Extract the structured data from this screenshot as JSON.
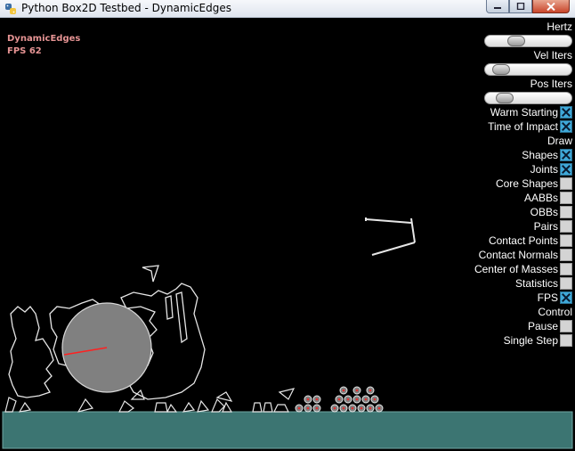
{
  "window": {
    "title": "Python Box2D Testbed - DynamicEdges"
  },
  "hud": {
    "test_name": "DynamicEdges",
    "fps_text": "FPS 62"
  },
  "colors": {
    "ground": "#3c7572",
    "shape_outline": "#e6e6e6",
    "circle_fill": "#808080",
    "joint_line": "#ff2020",
    "hud_text": "#e69494",
    "checkbox_on": "#3fa9d9"
  },
  "panel": {
    "hertz": {
      "label": "Hertz",
      "value_fraction": 0.32
    },
    "vel_iters": {
      "label": "Vel Iters",
      "value_fraction": 0.1
    },
    "pos_iters": {
      "label": "Pos Iters",
      "value_fraction": 0.15
    },
    "warm_starting": {
      "label": "Warm Starting",
      "checked": true
    },
    "time_of_impact": {
      "label": "Time of Impact",
      "checked": true
    },
    "draw_header": "Draw",
    "shapes": {
      "label": "Shapes",
      "checked": true
    },
    "joints": {
      "label": "Joints",
      "checked": true
    },
    "core_shapes": {
      "label": "Core Shapes",
      "checked": false
    },
    "aabbs": {
      "label": "AABBs",
      "checked": false
    },
    "obbs": {
      "label": "OBBs",
      "checked": false
    },
    "pairs": {
      "label": "Pairs",
      "checked": false
    },
    "contact_points": {
      "label": "Contact Points",
      "checked": false
    },
    "contact_normals": {
      "label": "Contact Normals",
      "checked": false
    },
    "center_of_masses": {
      "label": "Center of Masses",
      "checked": false
    },
    "statistics": {
      "label": "Statistics",
      "checked": false
    },
    "fps": {
      "label": "FPS",
      "checked": true
    },
    "control_header": "Control",
    "pause": {
      "label": "Pause",
      "checked": false
    },
    "single_step": {
      "label": "Single Step",
      "checked": false
    }
  }
}
